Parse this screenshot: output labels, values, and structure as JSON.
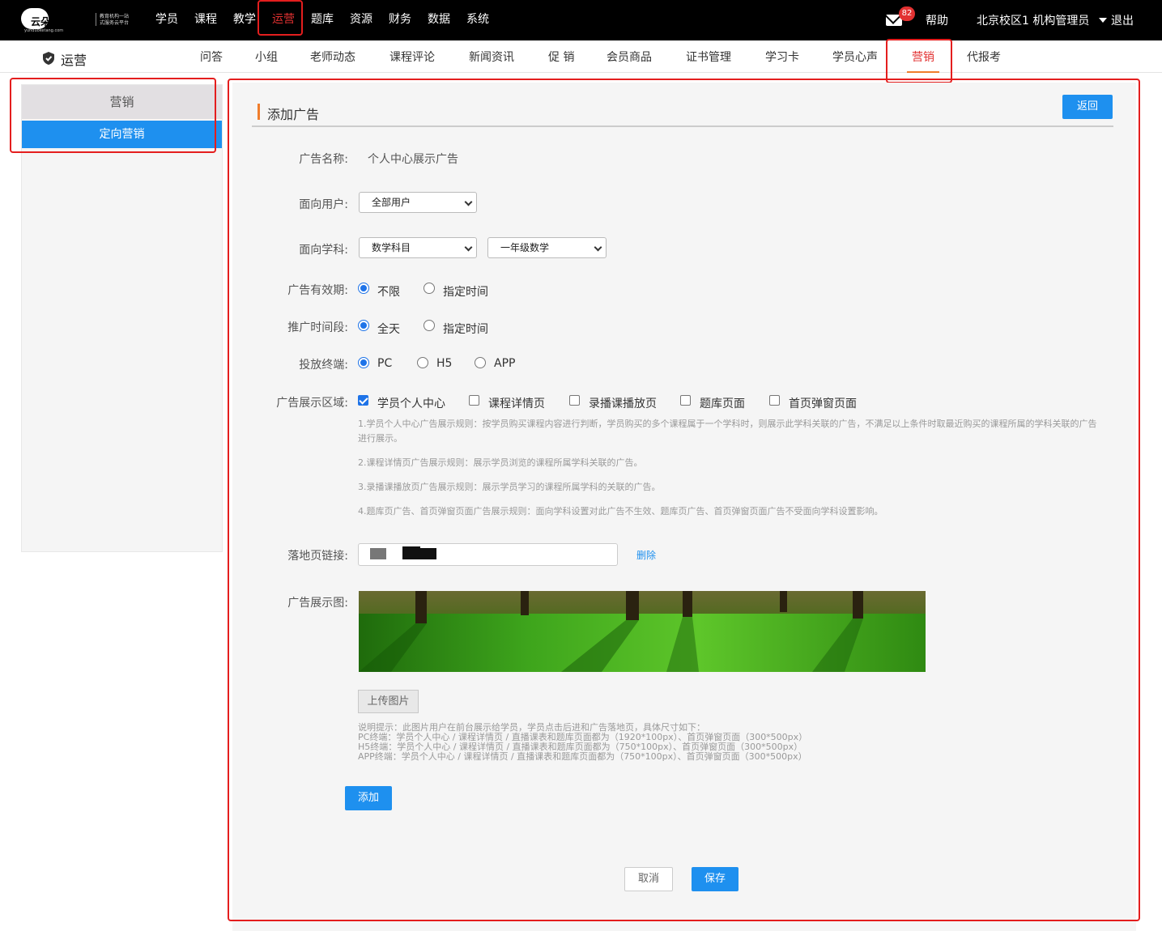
{
  "logo": {
    "brand": "云朵课堂",
    "url_text": "yunduoketang.com",
    "slogan_1": "教育机构一站",
    "slogan_2": "式服务云平台"
  },
  "topnav": {
    "items": [
      "学员",
      "课程",
      "教学",
      "运营",
      "题库",
      "资源",
      "财务",
      "数据",
      "系统"
    ],
    "active": "运营"
  },
  "header": {
    "mail_badge": "82",
    "help": "帮助",
    "user": "北京校区1 机构管理员",
    "logout": "退出"
  },
  "subnav": {
    "section": "运营",
    "items": [
      "问答",
      "小组",
      "老师动态",
      "课程评论",
      "新闻资讯",
      "促 销",
      "会员商品",
      "证书管理",
      "学习卡",
      "学员心声",
      "营销",
      "代报考"
    ],
    "active": "营销"
  },
  "sidebar": {
    "title": "营销",
    "items": [
      "定向营销"
    ]
  },
  "panel": {
    "title": "添加广告",
    "back_label": "返回"
  },
  "form": {
    "name_label": "广告名称:",
    "name_value": "个人中心展示广告",
    "audience_label": "面向用户:",
    "audience_value": "全部用户",
    "subject_label": "面向学科:",
    "subject_value": "数学科目",
    "grade_value": "一年级数学",
    "validity_label": "广告有效期:",
    "validity_options": [
      "不限",
      "指定时间"
    ],
    "validity_selected": "不限",
    "period_label": "推广时间段:",
    "period_options": [
      "全天",
      "指定时间"
    ],
    "period_selected": "全天",
    "terminal_label": "投放终端:",
    "terminal_options": [
      "PC",
      "H5",
      "APP"
    ],
    "terminal_selected": "PC",
    "area_label": "广告展示区域:",
    "area_options": [
      "学员个人中心",
      "课程详情页",
      "录播课播放页",
      "题库页面",
      "首页弹窗页面"
    ],
    "area_checked": [
      "学员个人中心"
    ],
    "rules": [
      "1.学员个人中心广告展示规则：按学员购买课程内容进行判断，学员购买的多个课程属于一个学科时，则展示此学科关联的广告，不满足以上条件时取最近购买的课程所属的学科关联的广告进行展示。",
      "2.课程详情页广告展示规则：展示学员浏览的课程所属学科关联的广告。",
      "3.录播课播放页广告展示规则：展示学员学习的课程所属学科的关联的广告。",
      "4.题库页广告、首页弹窗页面广告展示规则：面向学科设置对此广告不生效、题库页广告、首页弹窗页面广告不受面向学科设置影响。"
    ],
    "link_label": "落地页链接:",
    "delete_label": "删除",
    "image_label": "广告展示图:",
    "upload_label": "上传图片",
    "tips": [
      "说明提示：此图片用户在前台展示给学员，学员点击后进和广告落地页，具体尺寸如下：",
      "PC终端：学员个人中心 / 课程详情页 / 直播课表和题库页面都为（1920*100px）、首页弹窗页面（300*500px）",
      "H5终端：学员个人中心 / 课程详情页 / 直播课表和题库页面都为（750*100px）、首页弹窗页面（300*500px）",
      "APP终端：学员个人中心 / 课程详情页 / 直播课表和题库页面都为（750*100px）、首页弹窗页面（300*500px）"
    ],
    "add_label": "添加",
    "cancel_label": "取消",
    "save_label": "保存"
  },
  "colors": {
    "primary": "#1e90ef",
    "highlight": "#e41e1e",
    "accent": "#f07d2c"
  },
  "icons": {
    "shield": "shield-icon",
    "mail": "mail-icon",
    "caret": "caret-down-icon"
  }
}
